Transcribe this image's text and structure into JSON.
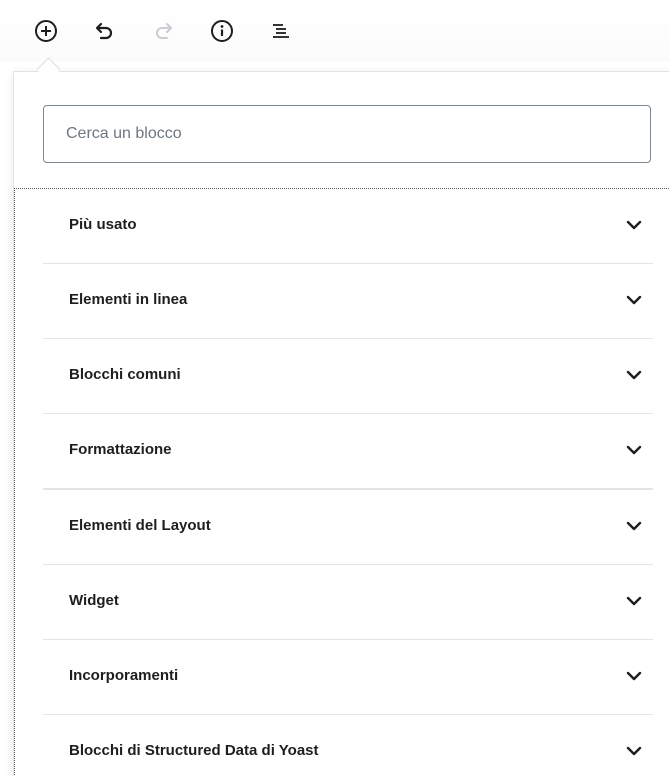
{
  "toolbar": {
    "items": [
      {
        "icon": "add-block-icon",
        "enabled": true
      },
      {
        "icon": "undo-icon",
        "enabled": true
      },
      {
        "icon": "redo-icon",
        "enabled": false
      },
      {
        "icon": "info-icon",
        "enabled": true
      },
      {
        "icon": "list-view-icon",
        "enabled": true
      }
    ]
  },
  "search": {
    "placeholder": "Cerca un blocco",
    "value": ""
  },
  "categories": [
    {
      "label": "Più usato",
      "expanded": false
    },
    {
      "label": "Elementi in linea",
      "expanded": false
    },
    {
      "label": "Blocchi comuni",
      "expanded": false
    },
    {
      "label": "Formattazione",
      "expanded": false
    },
    {
      "label": "Elementi del Layout",
      "expanded": false
    },
    {
      "label": "Widget",
      "expanded": false
    },
    {
      "label": "Incorporamenti",
      "expanded": false
    },
    {
      "label": "Blocchi di Structured Data di Yoast",
      "expanded": false
    }
  ],
  "colors": {
    "icon": "#1e1e1e",
    "icon_disabled": "#c9ccd0",
    "divider": "#e2e4e7",
    "input_border": "#7e8993"
  }
}
